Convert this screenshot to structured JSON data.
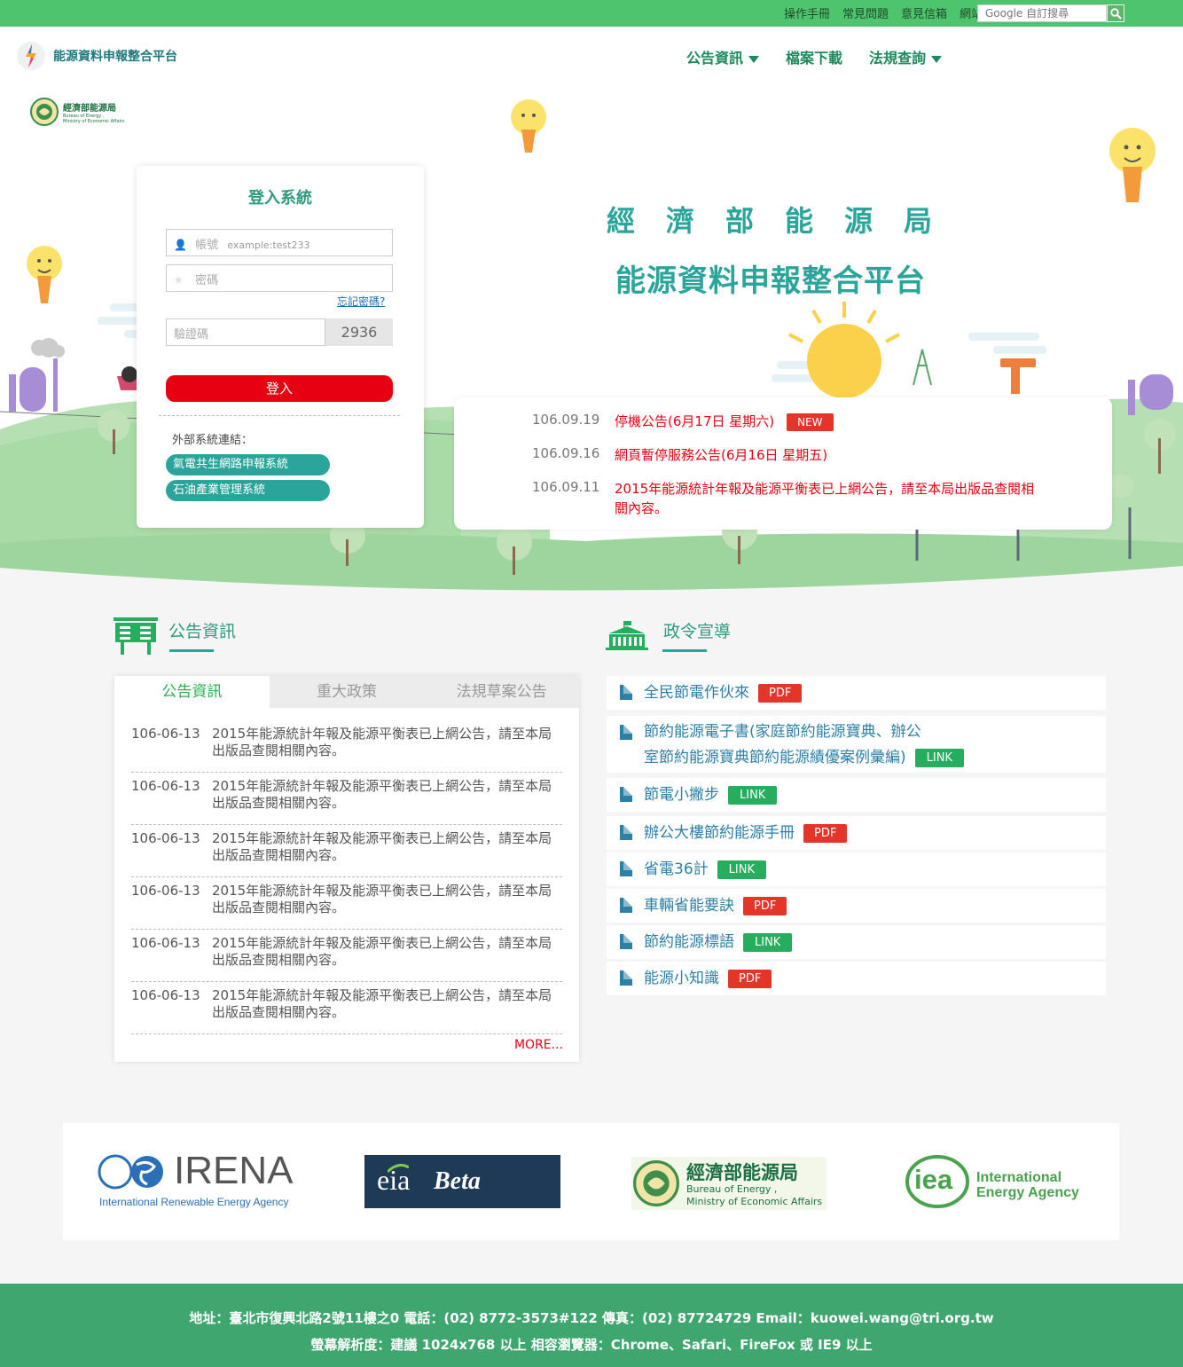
{
  "topbar": {
    "links": [
      "操作手冊",
      "常見問題",
      "意見信箱",
      "網站導覽"
    ],
    "search_placeholder": "Google 自訂搜尋"
  },
  "header": {
    "site_name": "能源資料申報整合平台",
    "nav": [
      "公告資訊",
      "檔案下載",
      "法規查詢"
    ]
  },
  "agency_logo": {
    "name": "經濟部能源局",
    "en_line1": "Bureau of Energy ,",
    "en_line2": "Ministry of Economic Affairs"
  },
  "login": {
    "title": "登入系統",
    "account_label": "帳號",
    "account_example": "example:test233",
    "password_label": "密碼",
    "forgot": "忘記密碼?",
    "captcha_label": "驗證碼",
    "captcha_code": "2936",
    "submit": "登入",
    "external_label": "外部系統連結：",
    "external_links": [
      "氣電共生網路申報系統",
      "石油產業管理系統"
    ]
  },
  "hero": {
    "title": "經濟部能源局",
    "subtitle": "能源資料申報整合平台"
  },
  "news": [
    {
      "date": "106.09.19",
      "title": "停機公告(6月17日 星期六)",
      "badge": "NEW"
    },
    {
      "date": "106.09.16",
      "title": "網頁暫停服務公告(6月16日 星期五)"
    },
    {
      "date": "106.09.11",
      "title": "2015年能源統計年報及能源平衡表已上網公告，請至本局出版品查閱相關內容。"
    }
  ],
  "announce": {
    "heading": "公告資訊",
    "tabs": [
      "公告資訊",
      "重大政策",
      "法規草案公告"
    ],
    "items": [
      {
        "date": "106-06-13",
        "title": "2015年能源統計年報及能源平衡表已上網公告，請至本局出版品查閱相關內容。"
      },
      {
        "date": "106-06-13",
        "title": "2015年能源統計年報及能源平衡表已上網公告，請至本局出版品查閱相關內容。"
      },
      {
        "date": "106-06-13",
        "title": "2015年能源統計年報及能源平衡表已上網公告，請至本局出版品查閱相關內容。"
      },
      {
        "date": "106-06-13",
        "title": "2015年能源統計年報及能源平衡表已上網公告，請至本局出版品查閱相關內容。"
      },
      {
        "date": "106-06-13",
        "title": "2015年能源統計年報及能源平衡表已上網公告，請至本局出版品查閱相關內容。"
      },
      {
        "date": "106-06-13",
        "title": "2015年能源統計年報及能源平衡表已上網公告，請至本局出版品查閱相關內容。"
      }
    ],
    "more": "MORE..."
  },
  "policy": {
    "heading": "政令宣導",
    "items": [
      {
        "title": "全民節電作伙來",
        "tag": "PDF"
      },
      {
        "title_line1": "節約能源電子書(家庭節約能源寶典、辦公",
        "title_line2": "室節約能源寶典節約能源績優案例彙編)",
        "tag": "LINK"
      },
      {
        "title": "節電小撇步",
        "tag": "LINK"
      },
      {
        "title": "辦公大樓節約能源手冊",
        "tag": "PDF"
      },
      {
        "title": "省電36計",
        "tag": "LINK"
      },
      {
        "title": "車輛省能要訣",
        "tag": "PDF"
      },
      {
        "title": "節約能源標語",
        "tag": "LINK"
      },
      {
        "title": "能源小知識",
        "tag": "PDF"
      }
    ]
  },
  "partners": {
    "irena": {
      "name": "IRENA",
      "full": "International Renewable Energy Agency"
    },
    "eia": {
      "name": "eia",
      "beta": "Beta"
    },
    "boe": {
      "name": "經濟部能源局",
      "en_line1": "Bureau of Energy ,",
      "en_line2": "Ministry of Economic Affairs"
    },
    "iea": {
      "name": "iea",
      "full_line1": "International",
      "full_line2": "Energy Agency"
    }
  },
  "footer": {
    "line1": "地址：臺北市復興北路2號11樓之0 電話：(02) 8772-3573#122 傳真：(02) 87724729 Email：kuowei.wang@tri.org.tw",
    "line2": "螢幕解析度：建議 1024x768 以上 相容瀏覽器：Chrome、Safari、FireFox 或 IE9 以上"
  },
  "colors": {
    "topbar": "#4fc46e",
    "brand_teal": "#2ba59b",
    "alert_red": "#e60012",
    "footer": "#3fa66f",
    "hill": "#9ed49e"
  }
}
